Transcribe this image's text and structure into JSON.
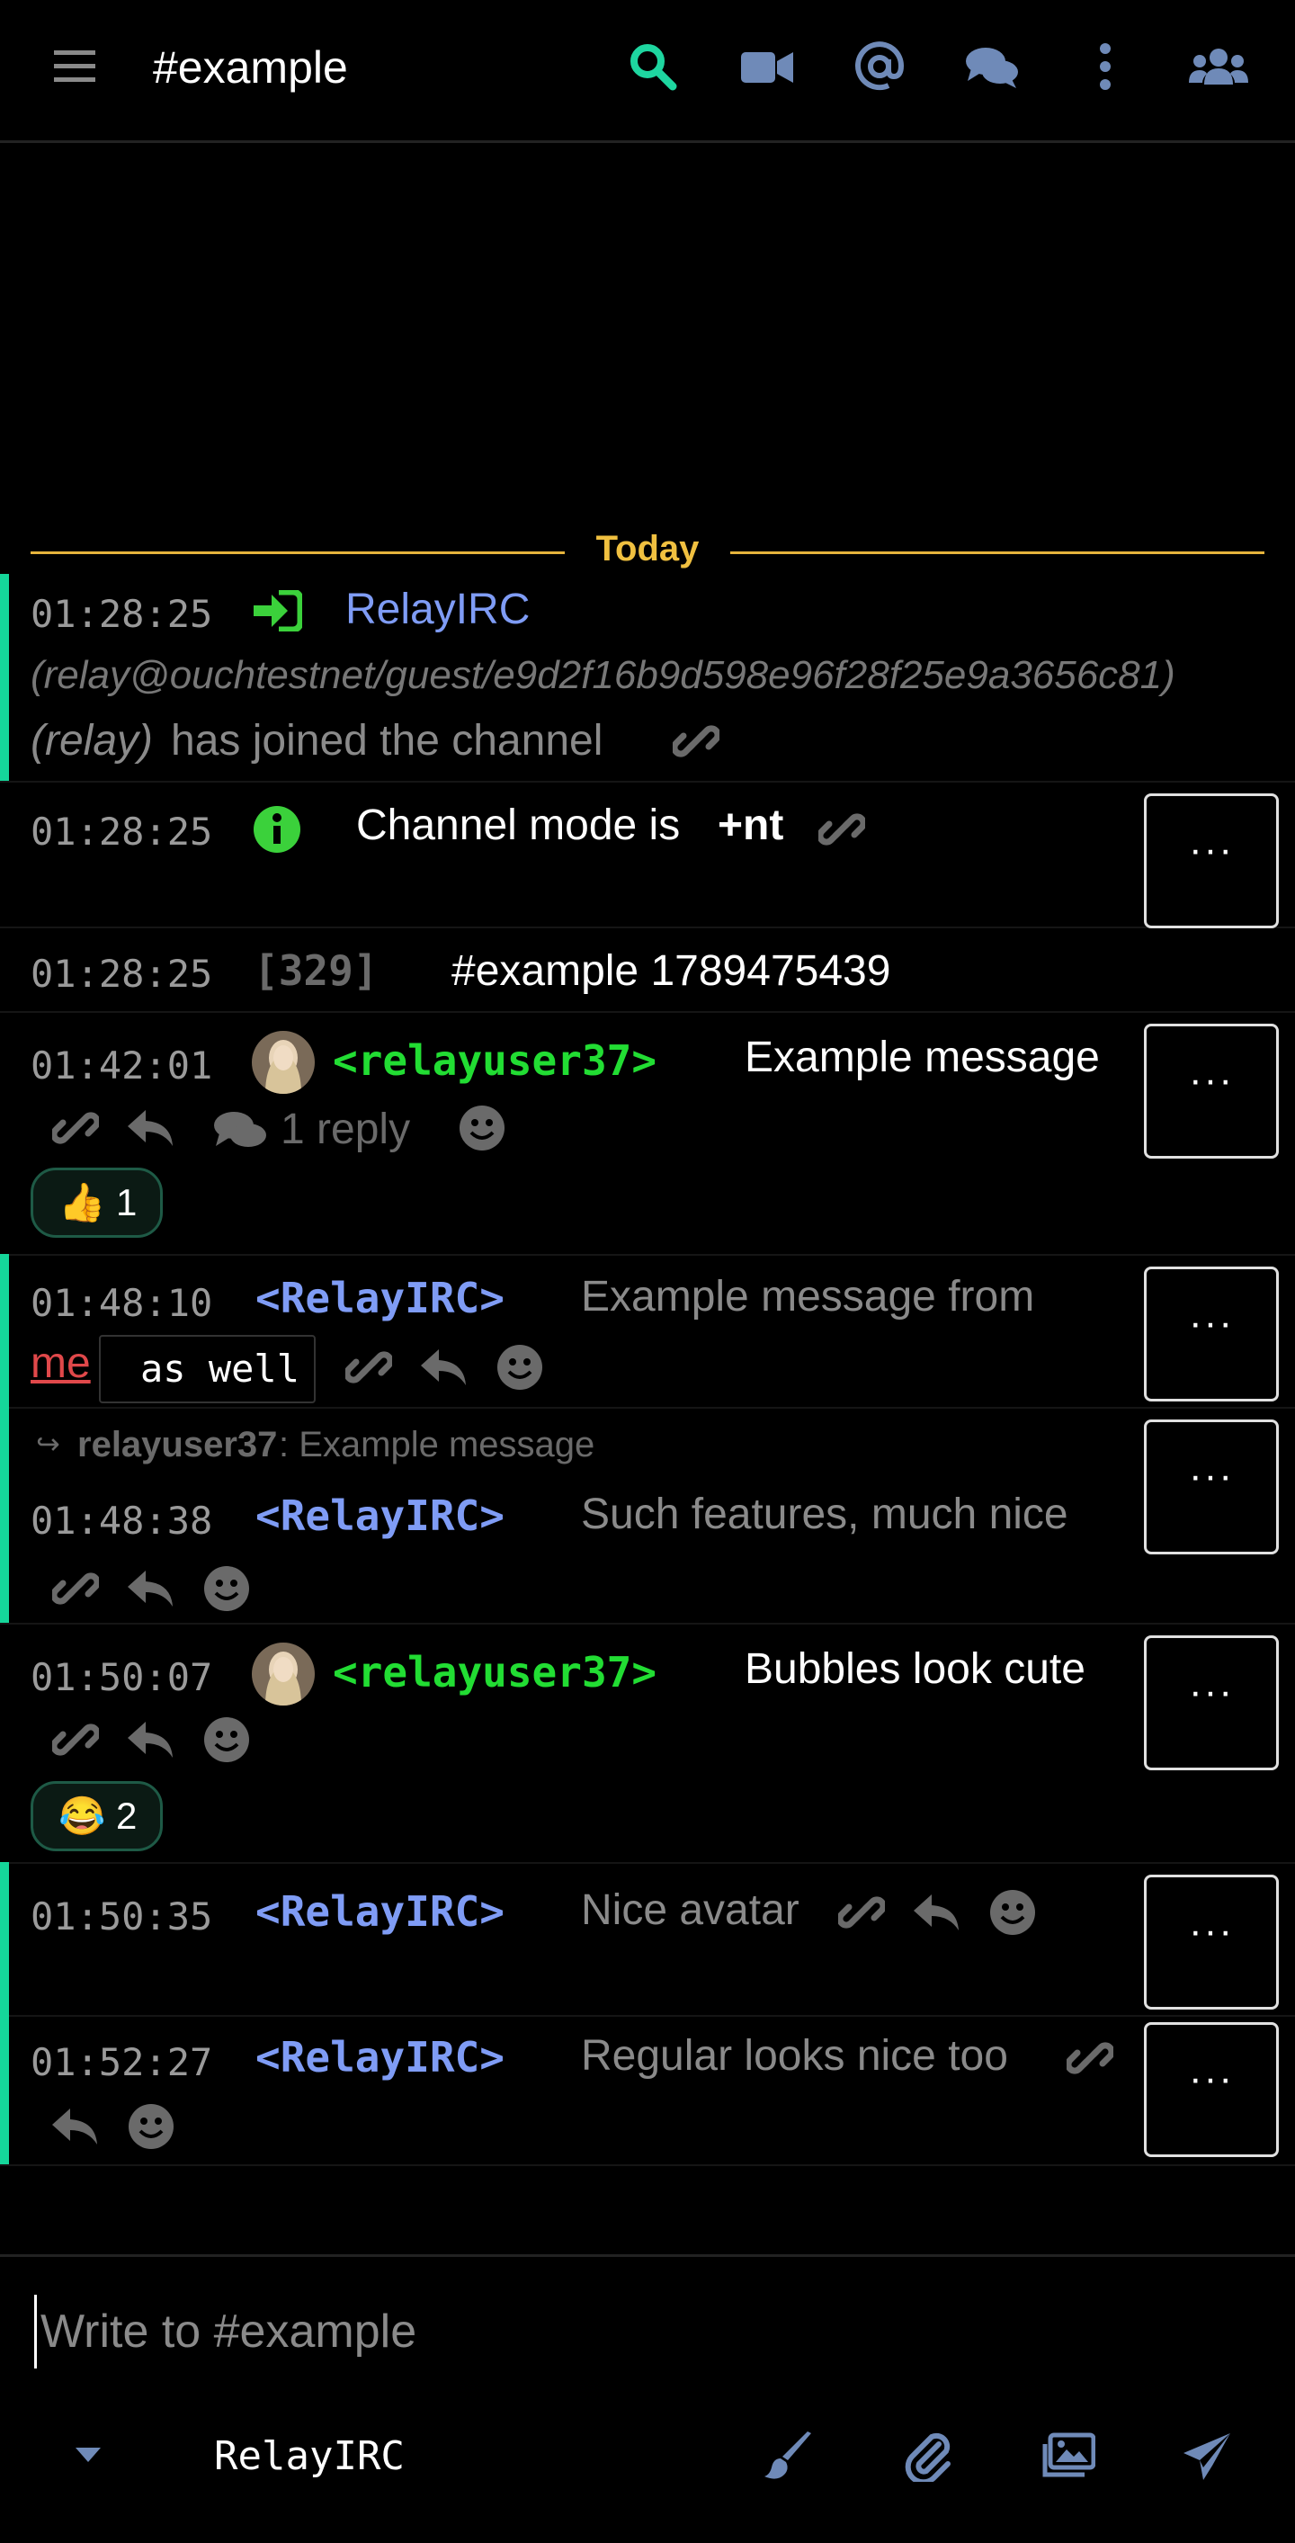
{
  "header": {
    "channel": "#example",
    "icons": [
      "menu-icon",
      "search-icon",
      "video-icon",
      "mention-icon",
      "chat-icon",
      "more-vertical-icon",
      "users-icon"
    ],
    "accent_color": "#1ed6a0",
    "icon_color": "#6f8ab8"
  },
  "divider": {
    "label": "Today"
  },
  "messages": [
    {
      "time": "01:28:25",
      "nick": "RelayIRC",
      "host": "(relay@ouchtestnet/guest/e9d2f16b9d598e96f28f25e9a3656c81)",
      "realname": "(relay)",
      "text": "has joined the channel"
    },
    {
      "time": "01:28:25",
      "text_prefix": "Channel mode is ",
      "mode": "+nt",
      "more": "···"
    },
    {
      "time": "01:28:25",
      "code": "[329]",
      "text": "#example 1789475439"
    },
    {
      "time": "01:42:01",
      "nick": "<relayuser37>",
      "text": "Example message",
      "reply_count": "1 reply",
      "reaction": {
        "emoji": "👍",
        "count": "1"
      },
      "more": "···"
    },
    {
      "time": "01:48:10",
      "nick": "<RelayIRC>",
      "text": "Example message from",
      "mention": "me",
      "tooltip": "as well",
      "more": "···"
    },
    {
      "time": "01:48:38",
      "reply_to_nick": "relayuser37",
      "reply_to_text": ": Example message",
      "nick": "<RelayIRC>",
      "text": "Such features, much nice",
      "more": "···"
    },
    {
      "time": "01:50:07",
      "nick": "<relayuser37>",
      "text": "Bubbles look cute",
      "reaction": {
        "emoji": "😂",
        "count": "2"
      },
      "more": "···"
    },
    {
      "time": "01:50:35",
      "nick": "<RelayIRC>",
      "text": "Nice avatar",
      "more": "···"
    },
    {
      "time": "01:52:27",
      "nick": "<RelayIRC>",
      "text": "Regular looks nice too",
      "more": "···"
    }
  ],
  "composer": {
    "placeholder": "Write to #example",
    "nick": "RelayIRC",
    "icons": [
      "caret-down-icon",
      "brush-icon",
      "paperclip-icon",
      "images-icon",
      "send-icon"
    ]
  }
}
